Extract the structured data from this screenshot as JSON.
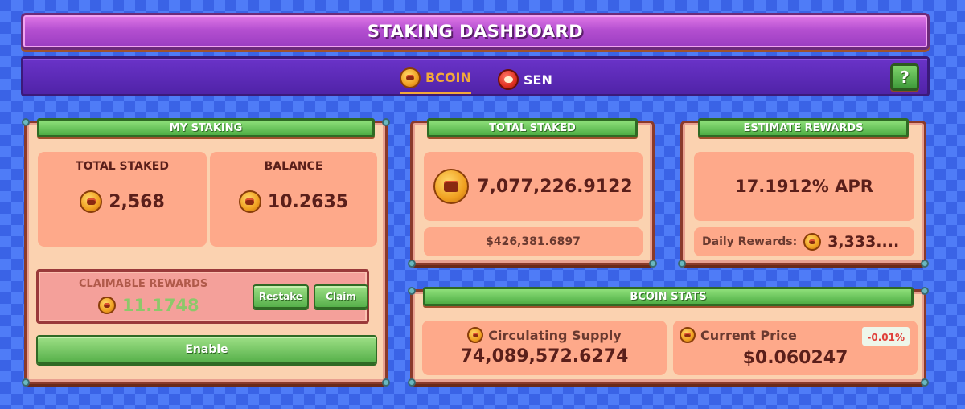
{
  "header": {
    "title": "STAKING DASHBOARD"
  },
  "tabs": [
    {
      "label": "BCOIN",
      "icon": "bcoin-icon",
      "active": true
    },
    {
      "label": "SEN",
      "icon": "sen-icon",
      "active": false
    }
  ],
  "help": {
    "label": "?"
  },
  "my_staking": {
    "title": "MY STAKING",
    "total_staked_label": "TOTAL STAKED",
    "total_staked_value": "2,568",
    "balance_label": "BALANCE",
    "balance_value": "10.2635",
    "claimable_label": "CLAIMABLE REWARDS",
    "claimable_value": "11.1748",
    "restake_label": "Restake",
    "claim_label": "Claim",
    "enable_label": "Enable"
  },
  "total_staked": {
    "title": "TOTAL STAKED",
    "value": "7,077,226.9122",
    "usd_value": "$426,381.6897"
  },
  "estimate_rewards": {
    "title": "ESTIMATE REWARDS",
    "apr": "17.1912% APR",
    "daily_label": "Daily Rewards:",
    "daily_value": "3,333...."
  },
  "bcoin_stats": {
    "title": "BCOIN STATS",
    "supply_label": "Circulating Supply",
    "supply_value": "74,089,572.6274",
    "price_label": "Current Price",
    "price_value": "$0.060247",
    "price_change": "-0.01%"
  },
  "colors": {
    "accent_orange": "#f2a93a",
    "panel_bg": "#fbd2b0",
    "card_bg": "#fea98a",
    "green": "#4eae44",
    "negative": "#e0403a"
  }
}
